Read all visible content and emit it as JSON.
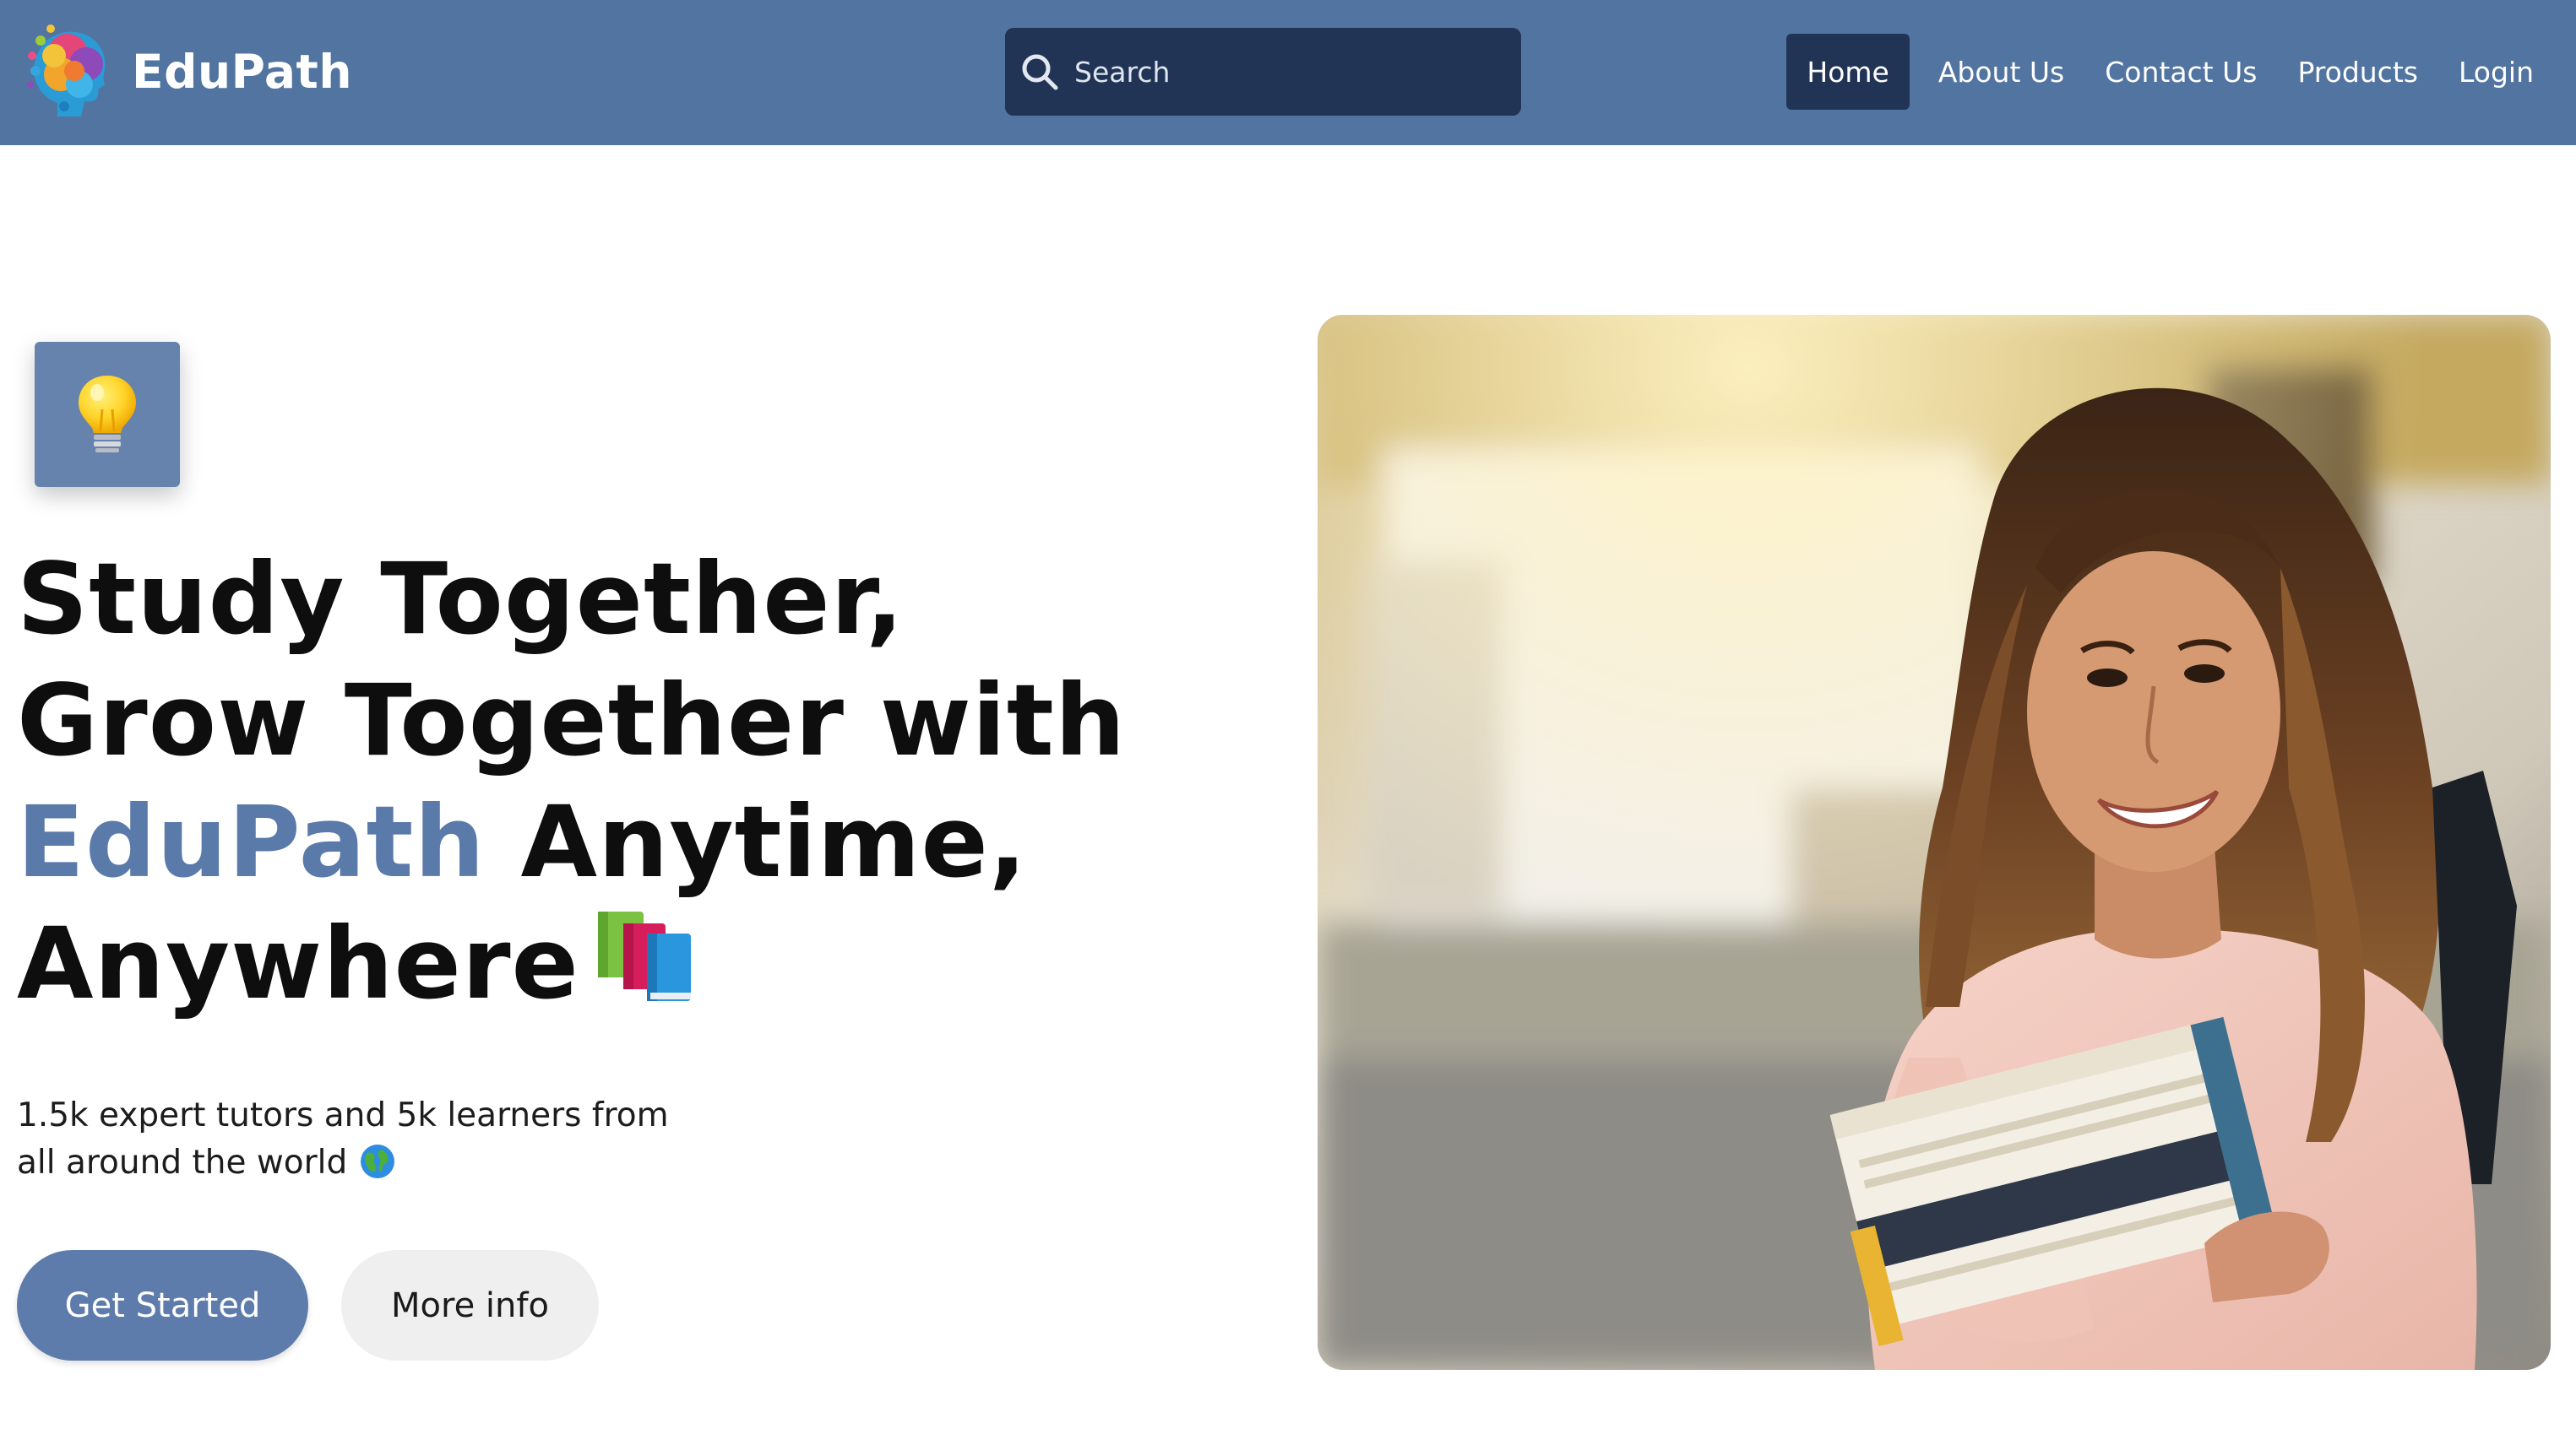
{
  "header": {
    "brand_name": "EduPath",
    "logo_icon": "head-brain-colorful-logo",
    "search": {
      "placeholder": "Search",
      "icon": "search-icon"
    },
    "nav": {
      "items": [
        {
          "label": "Home",
          "active": true
        },
        {
          "label": "About Us",
          "active": false
        },
        {
          "label": "Contact Us",
          "active": false
        },
        {
          "label": "Products",
          "active": false
        },
        {
          "label": "Login",
          "active": false
        }
      ]
    }
  },
  "hero": {
    "badge_icon": "lightbulb-icon",
    "headline": {
      "part1": "Study Together, Grow Together with",
      "accent": "EduPath",
      "part2": "Anytime, Anywhere",
      "emoji_icon": "books-icon"
    },
    "subtext": "1.5k expert tutors and 5k learners from all around the world",
    "subtext_icon": "globe-icon",
    "buttons": {
      "primary": "Get Started",
      "secondary": "More info"
    },
    "image": "student-holding-books-photo"
  },
  "colors": {
    "nav_bg": "#5274a1",
    "search_bg": "#213456",
    "active_nav_bg": "#213456",
    "accent": "#5a7aaa",
    "primary_button": "#5e7cab",
    "secondary_button": "#efefef"
  }
}
